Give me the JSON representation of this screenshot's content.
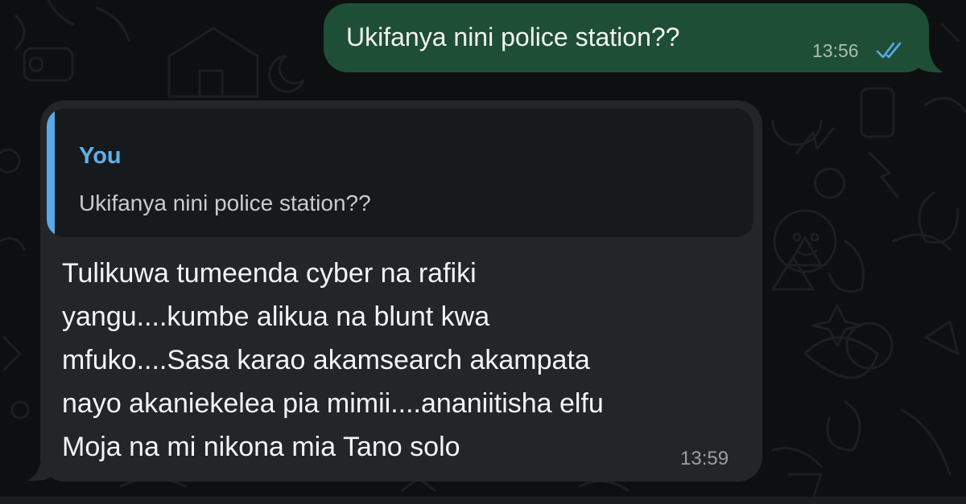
{
  "outgoing": {
    "text": "Ukifanya nini police station??",
    "time": "13:56",
    "status": "read",
    "bubble_color": "#1f4e36",
    "tick_color": "#5aa8e8"
  },
  "incoming": {
    "reply_to": {
      "author": "You",
      "text": "Ukifanya nini police station??",
      "accent_color": "#5aa8e8"
    },
    "lines": [
      "Tulikuwa tumeenda cyber na rafiki",
      "yangu....kumbe alikua na blunt kwa",
      "mfuko....Sasa karao akamsearch akampata",
      "nayo akaniekelea pia mimii....ananiitisha elfu",
      "Moja na mi nikona mia Tano solo"
    ],
    "time": "13:59",
    "bubble_color": "#232527"
  },
  "icons": {
    "read_receipt": "double-check-icon",
    "wallpaper": "doodle-pattern"
  }
}
